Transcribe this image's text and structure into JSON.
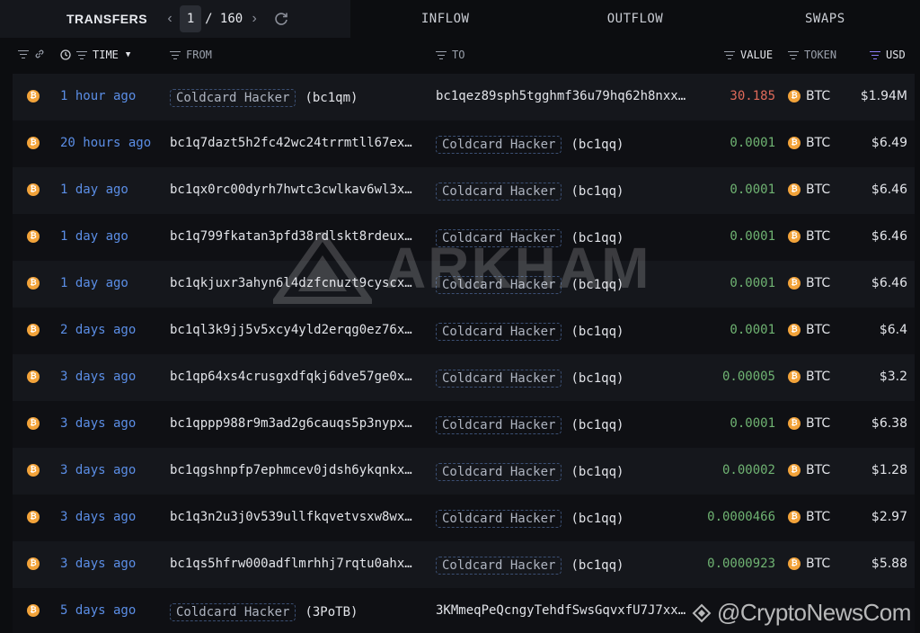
{
  "topbar": {
    "transfers_label": "TRANSFERS",
    "page_current": "1",
    "page_separator": "/ 160",
    "tabs": [
      "INFLOW",
      "OUTFLOW",
      "SWAPS"
    ]
  },
  "columns": {
    "time": "TIME",
    "from": "FROM",
    "to": "TO",
    "value": "VALUE",
    "token": "TOKEN",
    "usd": "USD"
  },
  "colors": {
    "accent_link": "#5b8ee6",
    "inflow": "#6fb372",
    "outflow": "#e06a5a",
    "btc": "#f2a33a"
  },
  "rows": [
    {
      "time": "1 hour ago",
      "from_entity": "Coldcard Hacker",
      "from_tag": "(bc1qm)",
      "to_addr": "bc1qez89sph5tgghmf36u79hq62h8nxxxxxxxx",
      "value": "30.185",
      "dir": "out",
      "token": "BTC",
      "usd": "$1.94M"
    },
    {
      "time": "20 hours ago",
      "from_addr": "bc1q7dazt5h2fc42wc24trrmtll67exxxxxxxx",
      "to_entity": "Coldcard Hacker",
      "to_tag": "(bc1qq)",
      "value": "0.0001",
      "dir": "in",
      "token": "BTC",
      "usd": "$6.49"
    },
    {
      "time": "1 day ago",
      "from_addr": "bc1qx0rc00dyrh7hwtc3cwlkav6wl3xxxxxxxx",
      "to_entity": "Coldcard Hacker",
      "to_tag": "(bc1qq)",
      "value": "0.0001",
      "dir": "in",
      "token": "BTC",
      "usd": "$6.46"
    },
    {
      "time": "1 day ago",
      "from_addr": "bc1q799fkatan3pfd38rdlskt8rdeuxxxxxxxx",
      "to_entity": "Coldcard Hacker",
      "to_tag": "(bc1qq)",
      "value": "0.0001",
      "dir": "in",
      "token": "BTC",
      "usd": "$6.46"
    },
    {
      "time": "1 day ago",
      "from_addr": "bc1qkjuxr3ahyn6l4dzfcnuzt9cyscxxxxxxxx",
      "to_entity": "Coldcard Hacker",
      "to_tag": "(bc1qq)",
      "value": "0.0001",
      "dir": "in",
      "token": "BTC",
      "usd": "$6.46"
    },
    {
      "time": "2 days ago",
      "from_addr": "bc1ql3k9jj5v5xcy4yld2erqg0ez76xxxxxxxx",
      "to_entity": "Coldcard Hacker",
      "to_tag": "(bc1qq)",
      "value": "0.0001",
      "dir": "in",
      "token": "BTC",
      "usd": "$6.4"
    },
    {
      "time": "3 days ago",
      "from_addr": "bc1qp64xs4crusgxdfqkj6dve57ge0xxxxxxxx",
      "to_entity": "Coldcard Hacker",
      "to_tag": "(bc1qq)",
      "value": "0.00005",
      "dir": "in",
      "token": "BTC",
      "usd": "$3.2"
    },
    {
      "time": "3 days ago",
      "from_addr": "bc1qppp988r9m3ad2g6cauqs5p3nypxxxxxxxx",
      "to_entity": "Coldcard Hacker",
      "to_tag": "(bc1qq)",
      "value": "0.0001",
      "dir": "in",
      "token": "BTC",
      "usd": "$6.38"
    },
    {
      "time": "3 days ago",
      "from_addr": "bc1qgshnpfp7ephmcev0jdsh6ykqnkxxxxxxxx",
      "to_entity": "Coldcard Hacker",
      "to_tag": "(bc1qq)",
      "value": "0.00002",
      "dir": "in",
      "token": "BTC",
      "usd": "$1.28"
    },
    {
      "time": "3 days ago",
      "from_addr": "bc1q3n2u3j0v539ullfkqvetvsxw8wxxxxxxxx",
      "to_entity": "Coldcard Hacker",
      "to_tag": "(bc1qq)",
      "value": "0.0000466",
      "dir": "in",
      "token": "BTC",
      "usd": "$2.97"
    },
    {
      "time": "3 days ago",
      "from_addr": "bc1qs5hfrw000adflmrhhj7rqtu0ahxxxxxxxx",
      "to_entity": "Coldcard Hacker",
      "to_tag": "(bc1qq)",
      "value": "0.0000923",
      "dir": "in",
      "token": "BTC",
      "usd": "$5.88"
    },
    {
      "time": "5 days ago",
      "from_entity": "Coldcard Hacker",
      "from_tag": "(3PoTB)",
      "to_addr": "3KMmeqPeQcngyTehdfSwsGqvxfU7J7xxxxxxxx",
      "value": "",
      "dir": "out",
      "token": "",
      "usd": ""
    }
  ],
  "watermark": "ARKHAM",
  "footer_mark": "@CryptoNewsCom"
}
